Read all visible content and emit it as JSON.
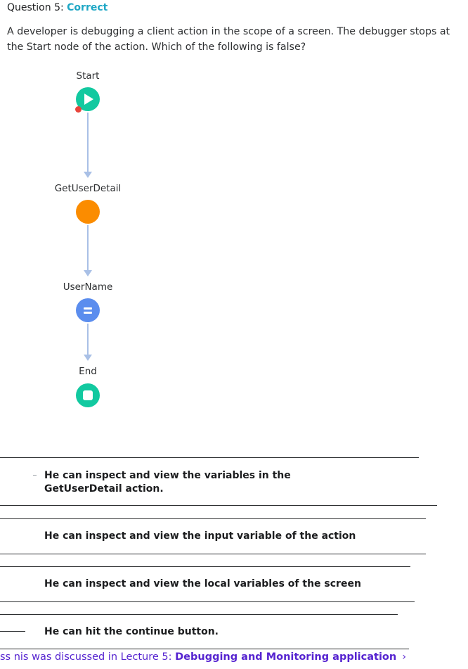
{
  "question": {
    "prefix": "Question 5: ",
    "status": "Correct",
    "text": "A developer is debugging a client action in the scope of a screen. The debugger stops at the Start node of the action. Which of the following is false?"
  },
  "flow": {
    "nodes": [
      {
        "label": "Start",
        "kind": "start",
        "icon": "play-icon",
        "color": "#12c9a0",
        "breakpoint": true
      },
      {
        "label": "GetUserDetail",
        "kind": "aggregate",
        "icon": "aggregate-icon",
        "color": "#fb8c00"
      },
      {
        "label": "UserName",
        "kind": "assign",
        "icon": "equals-icon",
        "color": "#5b8dee"
      },
      {
        "label": "End",
        "kind": "end",
        "icon": "stop-icon",
        "color": "#12c9a0"
      }
    ],
    "breakpoint_color": "#e8453c",
    "connector_color": "#a9c0e6"
  },
  "answers": [
    {
      "text": "He can inspect and view the variables in the GetUserDetail action."
    },
    {
      "text": "He can inspect and view the input variable of the action"
    },
    {
      "text": "He can inspect and view the local variables of the screen"
    },
    {
      "text": "He can hit the continue button."
    }
  ],
  "footer": {
    "prefix": "ss nis was discussed in Lecture 5: ",
    "link": "Debugging and Monitoring application",
    "chevron": "›",
    "color": "#5624d0"
  }
}
